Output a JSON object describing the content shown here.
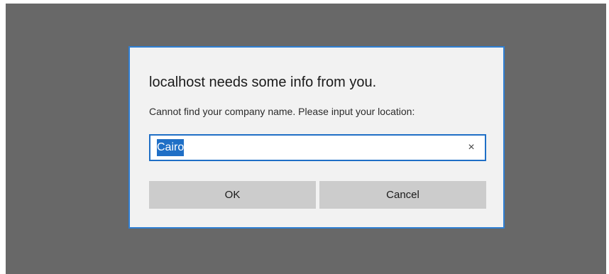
{
  "dialog": {
    "title": "localhost needs some info from you.",
    "message": "Cannot find your company name. Please input your location:",
    "input_value": "Cairo",
    "clear_icon": "×",
    "ok_label": "OK",
    "cancel_label": "Cancel"
  },
  "colors": {
    "overlay": "#686868",
    "dialog_background": "#f2f2f2",
    "accent": "#2f7fd3",
    "button_background": "#cccccc"
  }
}
